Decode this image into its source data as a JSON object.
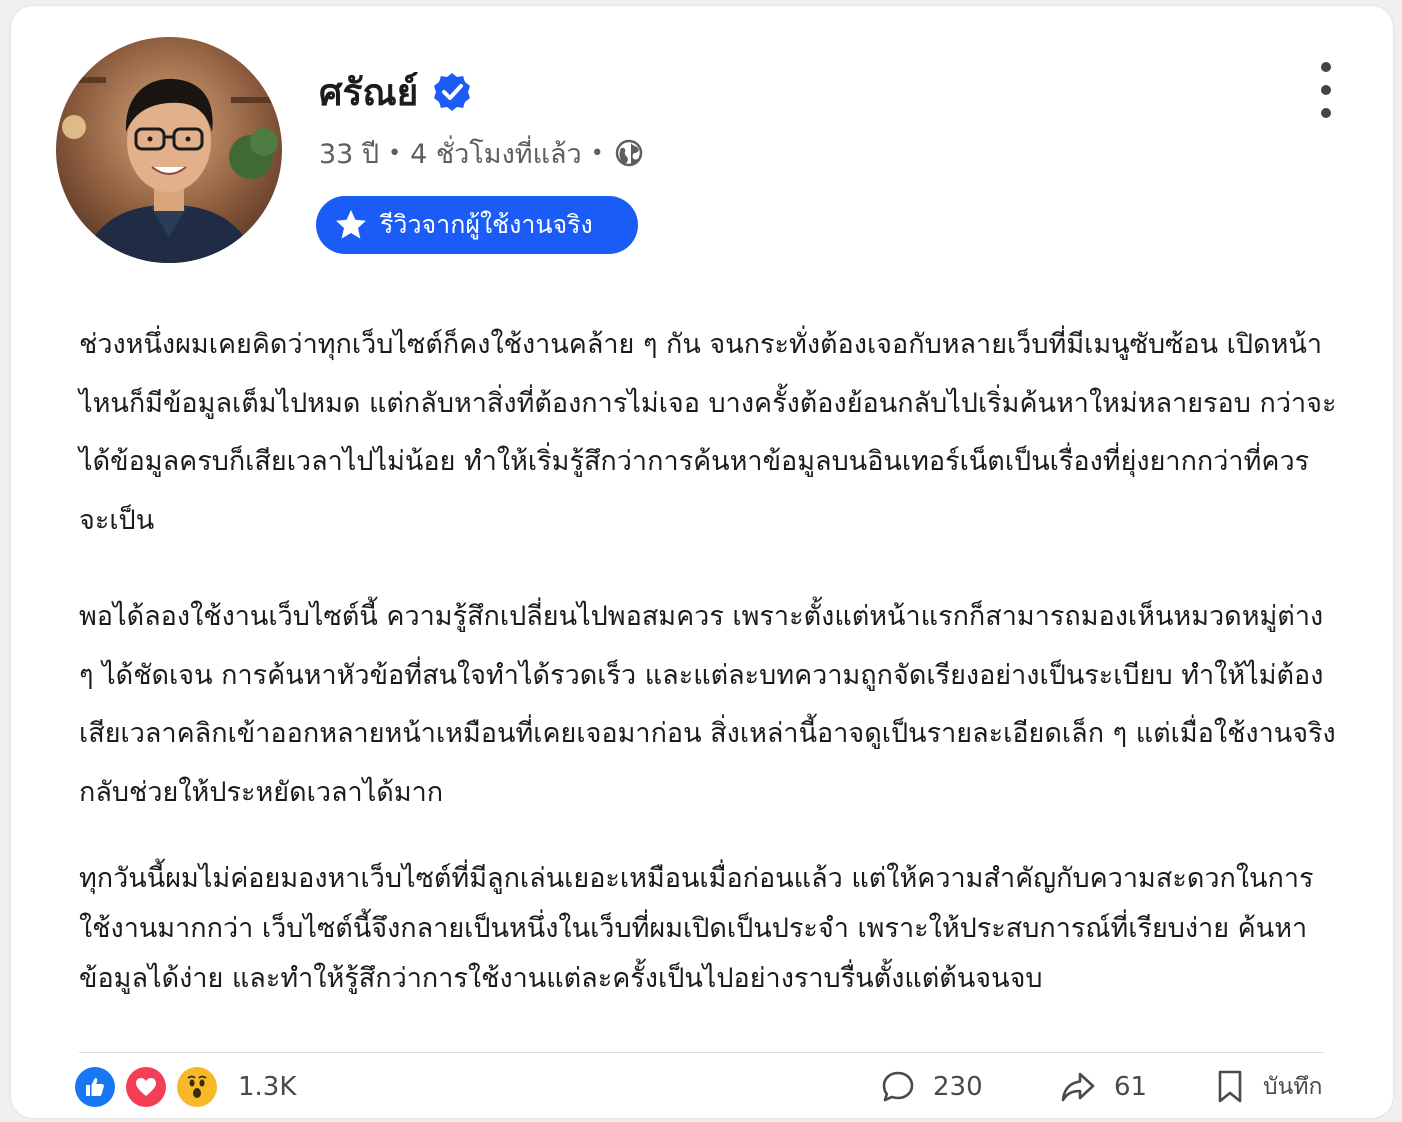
{
  "post": {
    "author_name": "ศรัณย์",
    "age": "33 ปี",
    "time_ago": "4 ชั่วโมงที่แล้ว",
    "badge_label": "รีวิวจากผู้ใช้งานจริง",
    "paragraph1": "ช่วงหนึ่งผมเคยคิดว่าทุกเว็บไซต์ก็คงใช้งานคล้าย ๆ กัน จนกระทั่งต้องเจอกับหลายเว็บที่มีเมนูซับซ้อน เปิดหน้าไหนก็มีข้อมูลเต็มไปหมด แต่กลับหาสิ่งที่ต้องการไม่เจอ บางครั้งต้องย้อนกลับไปเริ่มค้นหาใหม่หลายรอบ กว่าจะได้ข้อมูลครบก็เสียเวลาไปไม่น้อย ทำให้เริ่มรู้สึกว่าการค้นหาข้อมูลบนอินเทอร์เน็ตเป็นเรื่องที่ยุ่งยากกว่าที่ควรจะเป็น",
    "paragraph2": "พอได้ลองใช้งานเว็บไซต์นี้ ความรู้สึกเปลี่ยนไปพอสมควร เพราะตั้งแต่หน้าแรกก็สามารถมองเห็นหมวดหมู่ต่าง ๆ ได้ชัดเจน การค้นหาหัวข้อที่สนใจทำได้รวดเร็ว และแต่ละบทความถูกจัดเรียงอย่างเป็นระเบียบ ทำให้ไม่ต้องเสียเวลาคลิกเข้าออกหลายหน้าเหมือนที่เคยเจอมาก่อน สิ่งเหล่านี้อาจดูเป็นรายละเอียดเล็ก ๆ แต่เมื่อใช้งานจริงกลับช่วยให้ประหยัดเวลาได้มาก",
    "paragraph3": "ทุกวันนี้ผมไม่ค่อยมองหาเว็บไซต์ที่มีลูกเล่นเยอะเหมือนเมื่อก่อนแล้ว แต่ให้ความสำคัญกับความสะดวกในการใช้งานมากกว่า เว็บไซต์นี้จึงกลายเป็นหนึ่งในเว็บที่ผมเปิดเป็นประจำ เพราะให้ประสบการณ์ที่เรียบง่าย ค้นหาข้อมูลได้ง่าย และทำให้รู้สึกว่าการใช้งานแต่ละครั้งเป็นไปอย่างราบรื่นตั้งแต่ต้นจนจบ"
  },
  "footer": {
    "reaction_count": "1.3K",
    "comment_count": "230",
    "share_count": "61",
    "save_label": "บันทึก"
  },
  "colors": {
    "accent": "#1a5cf5",
    "verified": "#1a5cf5",
    "like": "#1877f2",
    "love": "#f33e58",
    "wow": "#f7b928"
  },
  "icons": [
    "verified-icon",
    "globe-icon",
    "star-icon",
    "more-icon",
    "like-icon",
    "love-icon",
    "wow-icon",
    "comment-icon",
    "share-icon",
    "bookmark-icon"
  ]
}
